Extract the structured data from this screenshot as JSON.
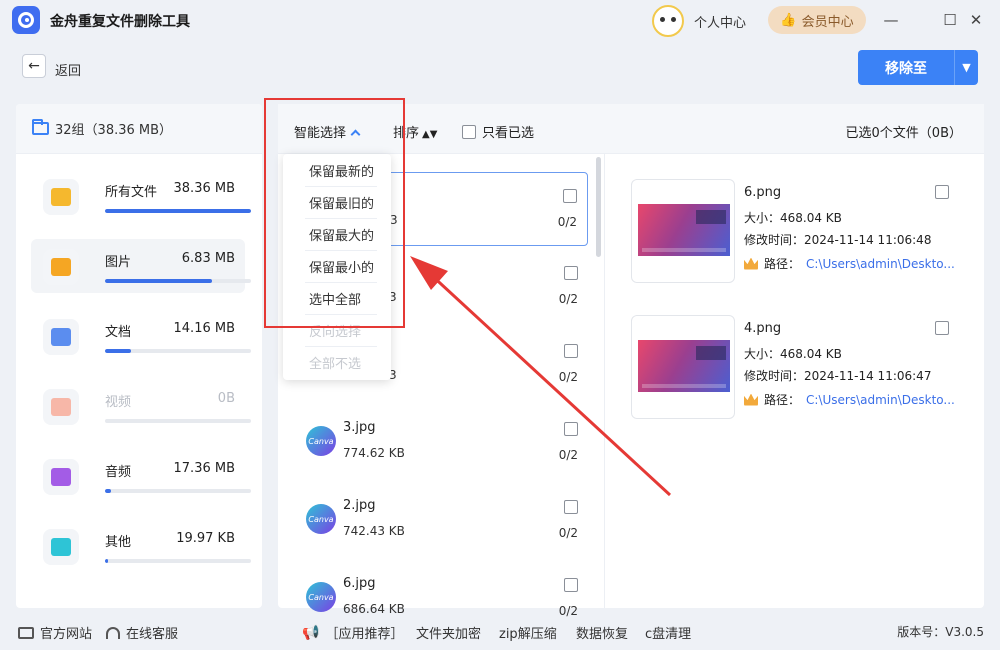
{
  "app": {
    "title": "金舟重复文件删除工具"
  },
  "header": {
    "user_center": "个人中心",
    "vip_center": "会员中心"
  },
  "nav": {
    "back_label": "返回"
  },
  "actions": {
    "remove_label": "移除至"
  },
  "summary": {
    "groups": "32组（38.36 MB）"
  },
  "categories": [
    {
      "name": "所有文件",
      "size": "38.36 MB",
      "fill": 1.0,
      "icon": "folder-icon",
      "color": "#f5b82e"
    },
    {
      "name": "图片",
      "size": "6.83 MB",
      "fill": 0.73,
      "icon": "image-icon",
      "color": "#f5a623"
    },
    {
      "name": "文档",
      "size": "14.16 MB",
      "fill": 0.18,
      "icon": "document-icon",
      "color": "#5b8def"
    },
    {
      "name": "视频",
      "size": "0B",
      "fill": 0.0,
      "icon": "video-icon",
      "color": "#f7b7a8"
    },
    {
      "name": "音频",
      "size": "17.36 MB",
      "fill": 0.04,
      "icon": "music-icon",
      "color": "#a35ce6"
    },
    {
      "name": "其他",
      "size": "19.97 KB",
      "fill": 0.02,
      "icon": "other-icon",
      "color": "#2ec4d6"
    }
  ],
  "toolbar": {
    "smart_select": "智能选择",
    "sort": "排序",
    "only_checked": "只看已选",
    "selected_info": "已选0个文件（0B）"
  },
  "dropdown": [
    {
      "label": "保留最新的",
      "enabled": true
    },
    {
      "label": "保留最旧的",
      "enabled": true
    },
    {
      "label": "保留最大的",
      "enabled": true
    },
    {
      "label": "保留最小的",
      "enabled": true
    },
    {
      "label": "选中全部",
      "enabled": true
    },
    {
      "label": "反向选择",
      "enabled": false
    },
    {
      "label": "全部不选",
      "enabled": false
    }
  ],
  "file_rows": [
    {
      "name": "",
      "size": "3",
      "count": "0/2"
    },
    {
      "name": "",
      "size": "3",
      "count": "0/2"
    },
    {
      "name": "",
      "size": "3",
      "count": "0/2"
    },
    {
      "name": "3.jpg",
      "size": "774.62 KB",
      "count": "0/2",
      "thumb": "Canva"
    },
    {
      "name": "2.jpg",
      "size": "742.43 KB",
      "count": "0/2",
      "thumb": "Canva"
    },
    {
      "name": "6.jpg",
      "size": "686.64 KB",
      "count": "0/2",
      "thumb": "Canva"
    }
  ],
  "details": [
    {
      "name": "6.png",
      "size": "大小：468.04 KB",
      "time": "修改时间：2024-11-14 11:06:48",
      "path_label": "路径：",
      "path": "C:\\Users\\admin\\Deskto..."
    },
    {
      "name": "4.png",
      "size": "大小：468.04 KB",
      "time": "修改时间：2024-11-14 11:06:47",
      "path_label": "路径：",
      "path": "C:\\Users\\admin\\Deskto..."
    }
  ],
  "footer": {
    "website": "官方网站",
    "support": "在线客服",
    "apps": "［应用推荐］",
    "folder_encrypt": "文件夹加密",
    "zip": "zip解压缩",
    "recovery": "数据恢复",
    "c_clean": "c盘清理",
    "version": "版本号：V3.0.5"
  }
}
